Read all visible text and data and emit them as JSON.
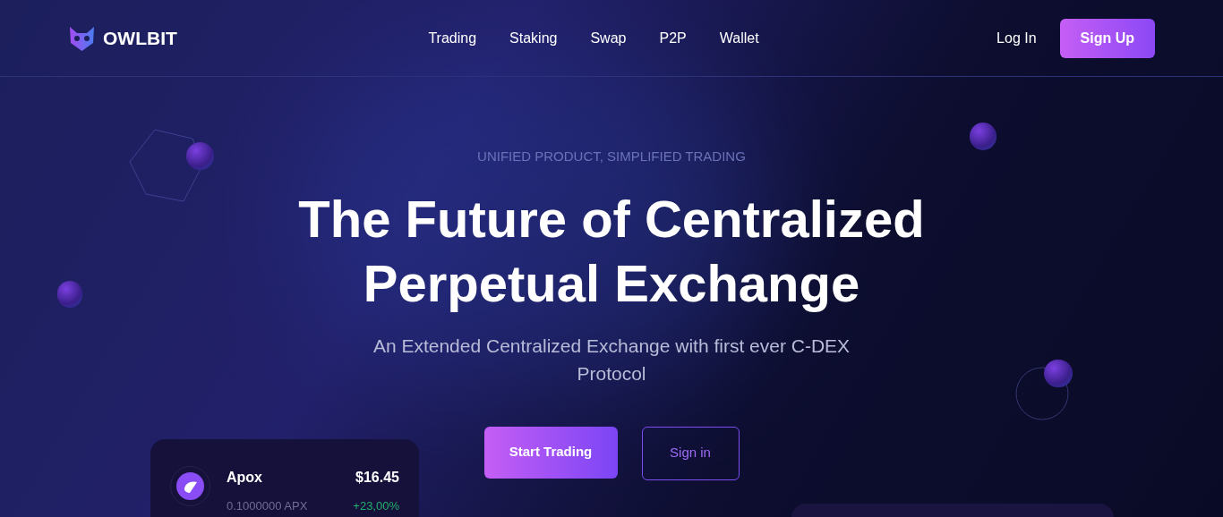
{
  "brand": {
    "name": "OWLBIT"
  },
  "nav": [
    {
      "label": "Trading"
    },
    {
      "label": "Staking"
    },
    {
      "label": "Swap"
    },
    {
      "label": "P2P"
    },
    {
      "label": "Wallet"
    }
  ],
  "auth": {
    "login": "Log In",
    "signup": "Sign Up"
  },
  "hero": {
    "eyebrow": "UNIFIED PRODUCT, SIMPLIFIED TRADING",
    "title_lines": [
      "The Future of Centralized",
      "Perpetual Exchange"
    ],
    "subtitle": "An Extended Centralized Exchange with first ever C-DEX Protocol",
    "buttons": [
      {
        "label": "Start Trading",
        "kind": "primary"
      },
      {
        "label": "Sign in",
        "kind": "outline"
      }
    ]
  },
  "asset_card": {
    "name": "Apox",
    "amount": "0.1000000 APX",
    "price": "$16.45",
    "change": "+23,00%"
  }
}
